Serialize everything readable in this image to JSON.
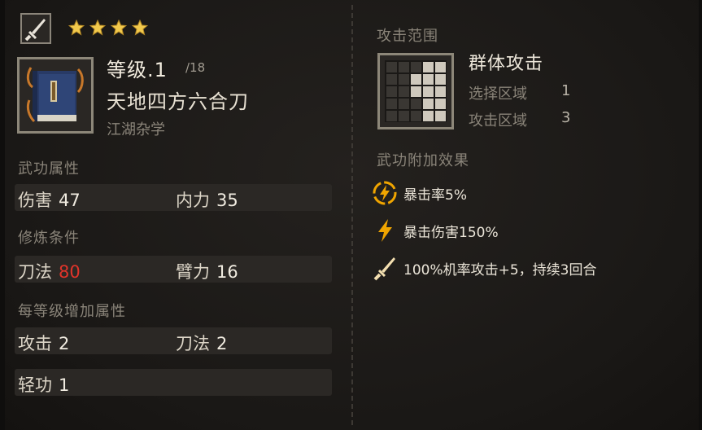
{
  "header": {
    "weapon_type_icon": "sword-icon",
    "stars": 4,
    "star_color": "#f2c94c"
  },
  "skill": {
    "level_label": "等级.1",
    "level_max": "/18",
    "name": "天地四方六合刀",
    "category": "江湖杂学",
    "icon": "blue-book-icon"
  },
  "attributes": {
    "label": "武功属性",
    "damage_label": "伤害",
    "damage_value": "47",
    "internal_label": "内力",
    "internal_value": "35"
  },
  "requirements": {
    "label": "修炼条件",
    "blade_label": "刀法",
    "blade_value": "80",
    "arm_label": "臂力",
    "arm_value": "16",
    "unmet_color": "#e0342a"
  },
  "per_level": {
    "label": "每等级增加属性",
    "attack_label": "攻击",
    "attack_value": "2",
    "blade_label": "刀法",
    "blade_value": "2",
    "agility_label": "轻功",
    "agility_value": "1"
  },
  "attack_range": {
    "label": "攻击范围",
    "type": "群体攻击",
    "select_label": "选择区域",
    "select_value": "1",
    "attack_area_label": "攻击区域",
    "attack_area_value": "3",
    "icon": "range-grid-icon"
  },
  "effects": {
    "label": "武功附加效果",
    "items": [
      {
        "icon": "lightning-circle-icon",
        "text": "暴击率5%"
      },
      {
        "icon": "lightning-icon",
        "text": "暴击伤害150%"
      },
      {
        "icon": "sword-icon",
        "text": "100%机率攻击+5，持续3回合"
      }
    ]
  }
}
